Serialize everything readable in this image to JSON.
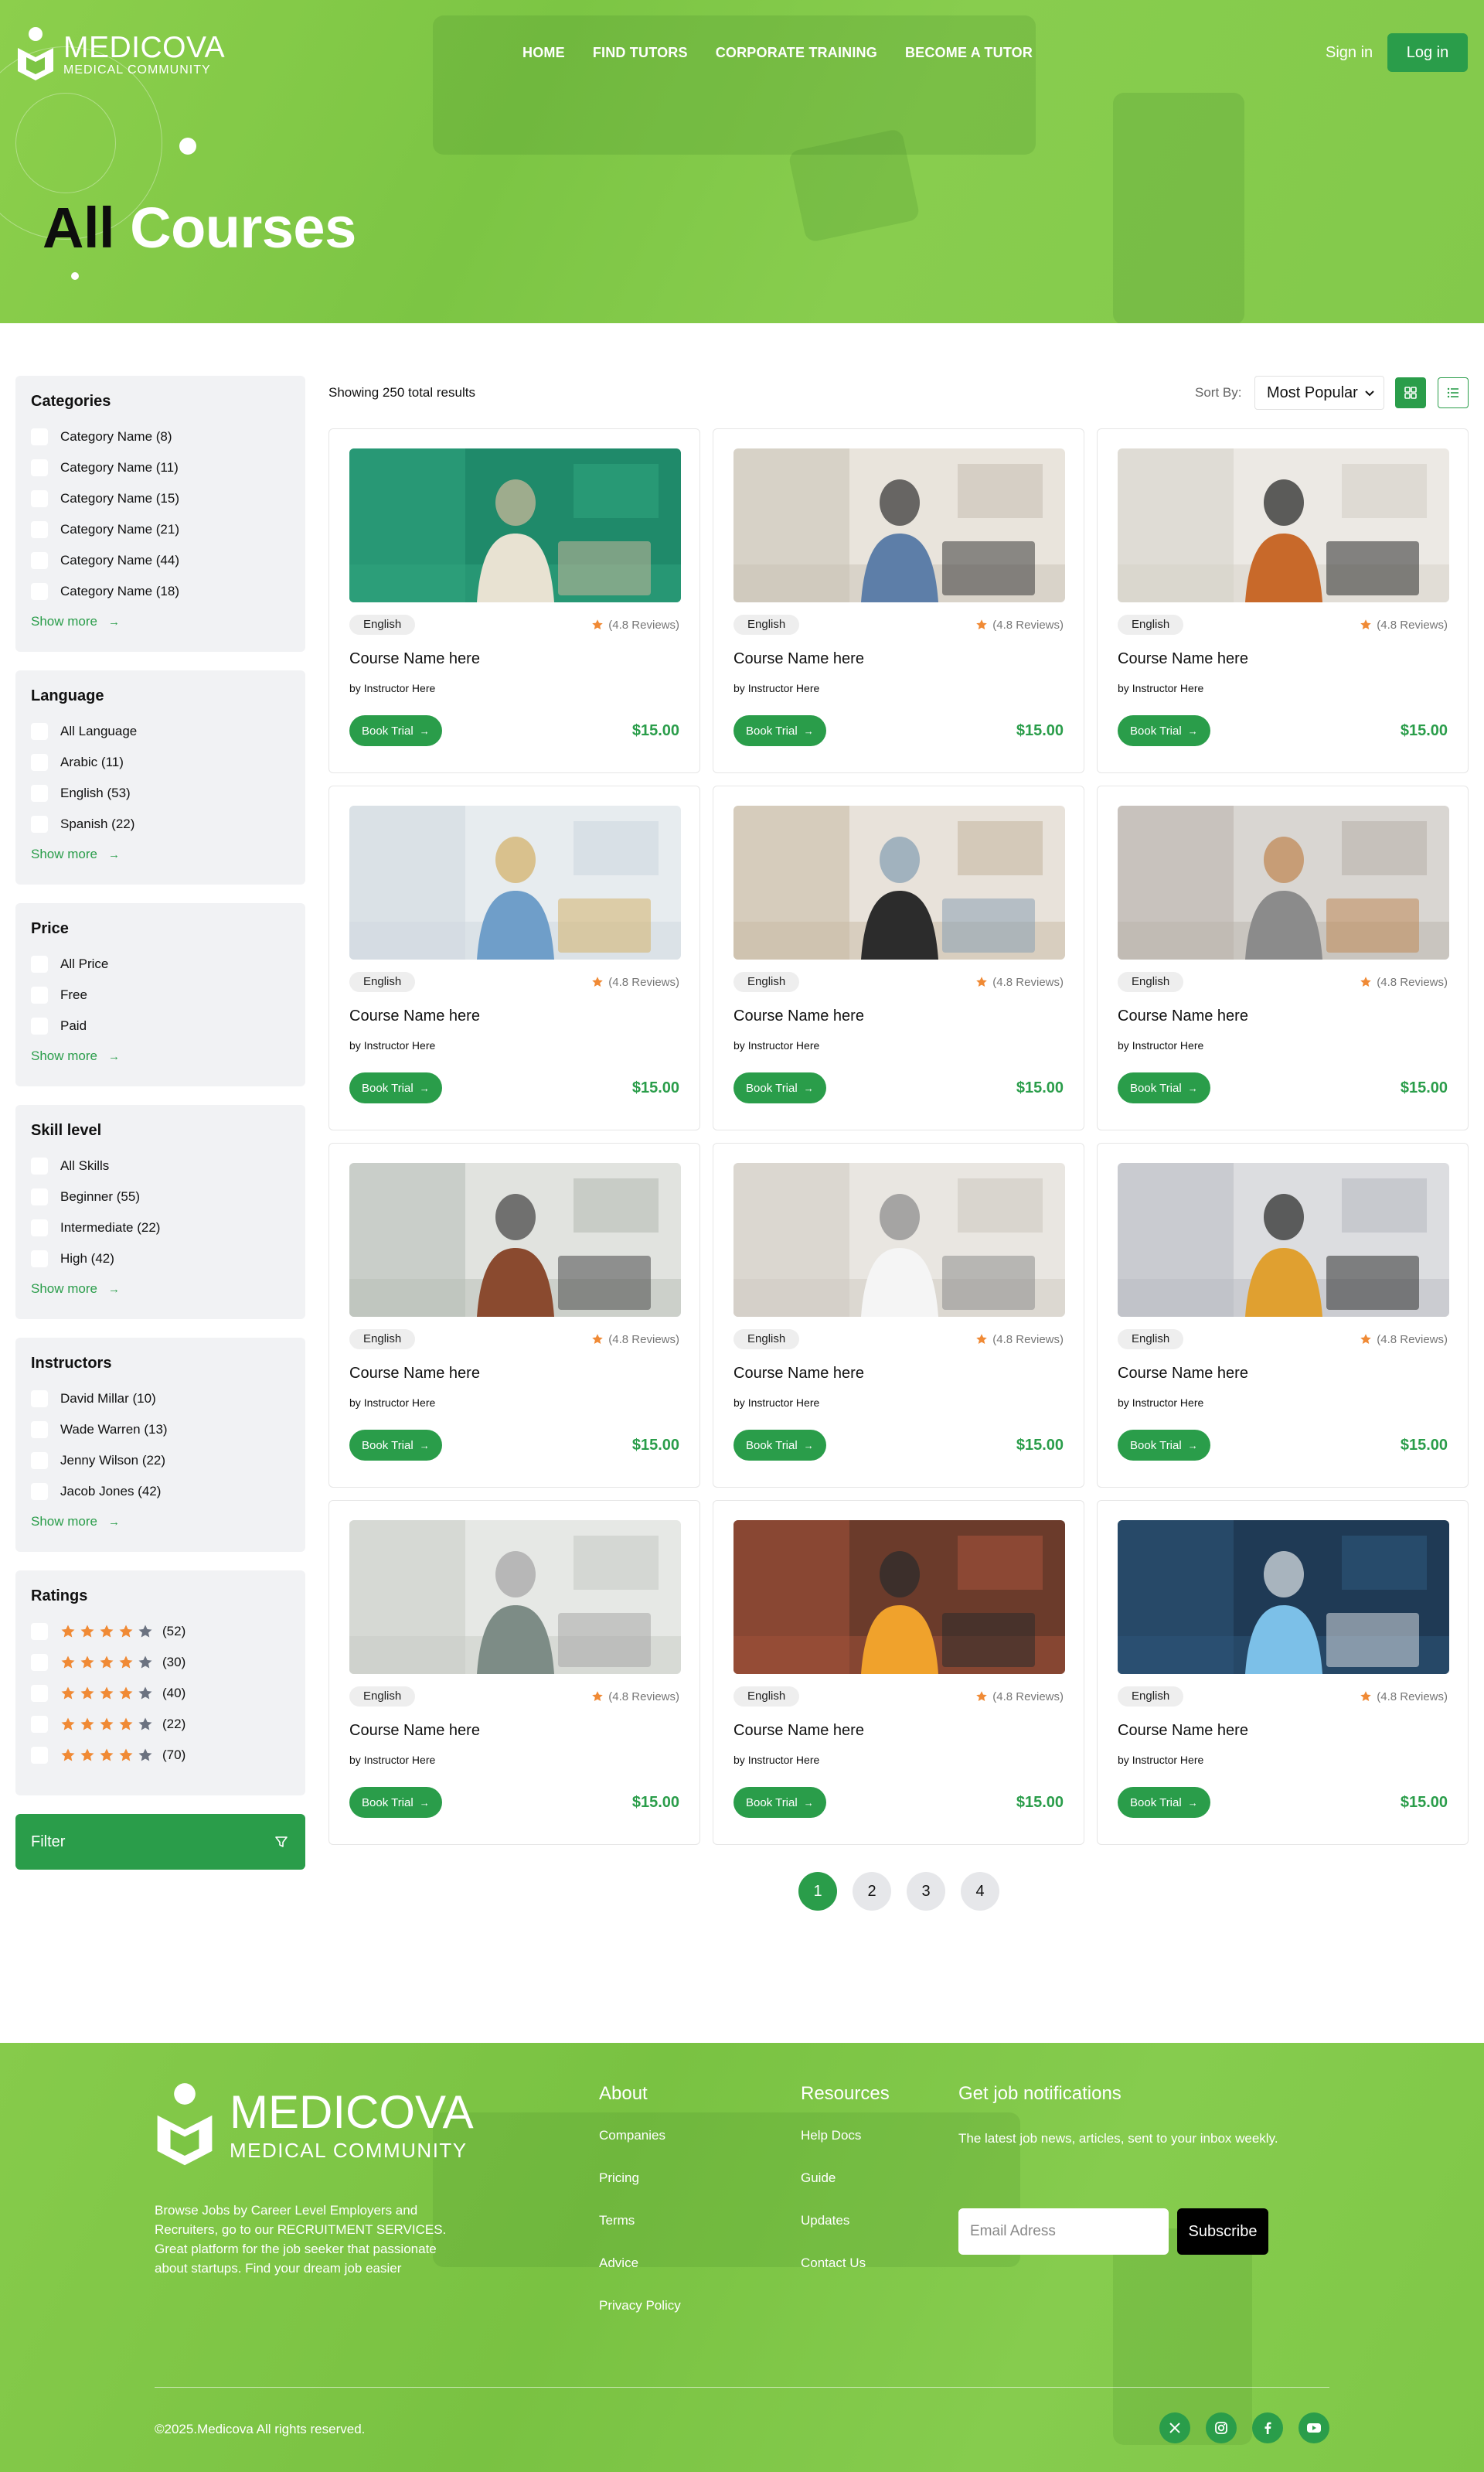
{
  "brand": {
    "name": "MEDICOVA",
    "subtitle": "MEDICAL COMMUNITY"
  },
  "nav": {
    "items": [
      "HOME",
      "FIND TUTORS",
      "CORPORATE TRAINING",
      "BECOME A TUTOR"
    ],
    "signin": "Sign in",
    "login": "Log in"
  },
  "hero": {
    "title_dark": "All",
    "title_light": "Courses"
  },
  "filters": {
    "categories": {
      "title": "Categories",
      "items": [
        "Category Name (8)",
        "Category Name (11)",
        "Category Name (15)",
        "Category Name (21)",
        "Category Name (44)",
        "Category Name (18)"
      ],
      "more": "Show more"
    },
    "language": {
      "title": "Language",
      "items": [
        "All Language",
        "Arabic (11)",
        "English (53)",
        "Spanish (22)"
      ],
      "more": "Show more"
    },
    "price": {
      "title": "Price",
      "items": [
        "All Price",
        "Free",
        "Paid"
      ],
      "more": "Show more"
    },
    "skill": {
      "title": "Skill level",
      "items": [
        "All Skills",
        "Beginner (55)",
        "Intermediate (22)",
        "High (42)"
      ],
      "more": "Show more"
    },
    "instructors": {
      "title": "Instructors",
      "items": [
        "David Millar (10)",
        "Wade Warren (13)",
        "Jenny Wilson (22)",
        "Jacob Jones (42)"
      ],
      "more": "Show more"
    },
    "ratings": {
      "title": "Ratings",
      "items": [
        {
          "count": "(52)",
          "filled": 4
        },
        {
          "count": "(30)",
          "filled": 4
        },
        {
          "count": "(40)",
          "filled": 4
        },
        {
          "count": "(22)",
          "filled": 4
        },
        {
          "count": "(70)",
          "filled": 4
        }
      ]
    },
    "filter_button": "Filter"
  },
  "toolbar": {
    "results": "Showing 250 total results",
    "sort_label": "Sort By:",
    "sort_value": "Most Popular"
  },
  "card_template": {
    "tag": "English",
    "reviews": "(4.8 Reviews)",
    "title": "Course Name here",
    "by": "by",
    "instructor": "Instructor Here",
    "book": "Book Trial",
    "price": "$15.00"
  },
  "card_count": 12,
  "pagination": [
    "1",
    "2",
    "3",
    "4"
  ],
  "footer": {
    "description": "Browse Jobs by Career Level Employers and Recruiters, go to our RECRUITMENT SERVICES. Great platform for the job seeker that passionate about startups. Find your dream job easier",
    "about": {
      "title": "About",
      "links": [
        "Companies",
        "Pricing",
        "Terms",
        "Advice",
        "Privacy Policy"
      ]
    },
    "resources": {
      "title": "Resources",
      "links": [
        "Help Docs",
        "Guide",
        "Updates",
        "Contact Us"
      ]
    },
    "notifications": {
      "title": "Get job notifications",
      "text": "The latest job news, articles, sent to your inbox weekly."
    },
    "email_placeholder": "Email Adress",
    "subscribe": "Subscribe",
    "copyright": "©2025.Medicova All rights reserved.",
    "social": [
      "x-icon",
      "instagram-icon",
      "facebook-icon",
      "youtube-icon"
    ]
  },
  "colors": {
    "primary": "#2a9d4a",
    "hero_green": "#7cc544",
    "star": "#f08a35",
    "star_empty": "#6b7280"
  }
}
